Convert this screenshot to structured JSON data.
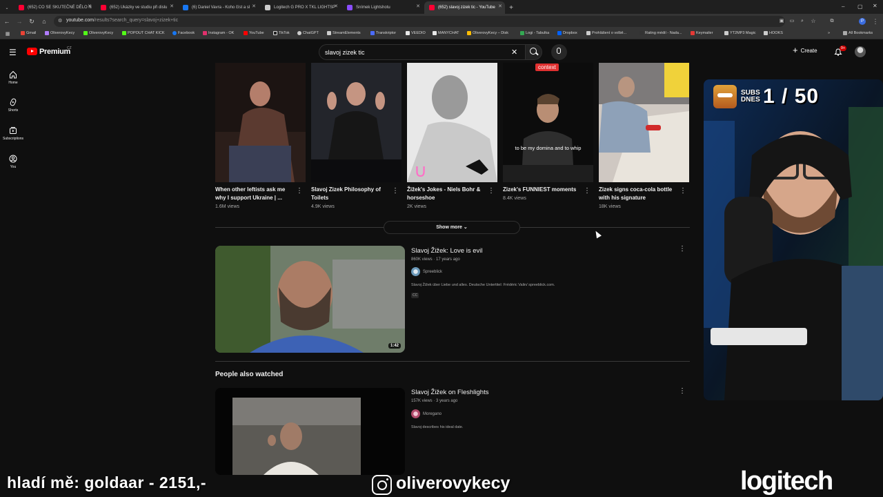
{
  "browser": {
    "tabs": [
      {
        "label": "(652) CO SE SKUTEČNÉ DĚLO N",
        "fav": "#ff0033"
      },
      {
        "label": "(652) Ukázky ve studiu při dislu",
        "fav": "#ff0033"
      },
      {
        "label": "(6) Daniel Vavra - Koho číst a sl",
        "fav": "#1877f2"
      },
      {
        "label": "Logitech G PRO X TKL LIGHTSP",
        "fav": "#cccccc"
      },
      {
        "label": "Snímek Lightshotu",
        "fav": "#8a4dff"
      },
      {
        "label": "(652) slavoj zizek tic - YouTube",
        "fav": "#ff0033"
      }
    ],
    "new_tab": "+",
    "url_host": "youtube.com",
    "url_path": "/results?search_query=slavoj+zizek+tic",
    "bookmarks": [
      {
        "label": "Gmail",
        "color": "#ea4335"
      },
      {
        "label": "OliverovyKecy",
        "color": "#b07cff"
      },
      {
        "label": "OliverovyKecy",
        "color": "#53fc18"
      },
      {
        "label": "POPOUT CHAT KICK",
        "color": "#53fc18"
      },
      {
        "label": "Facebook",
        "color": "#1877f2"
      },
      {
        "label": "Instagram - OK",
        "color": "#e1306c"
      },
      {
        "label": "YouTube",
        "color": "#ff0000"
      },
      {
        "label": "TikTok",
        "color": "#ffffff"
      },
      {
        "label": "ChatGPT",
        "color": "#cccccc"
      },
      {
        "label": "StreamElements",
        "color": "#cccccc"
      },
      {
        "label": "Transkriptor",
        "color": "#4b6bff"
      },
      {
        "label": "VEEDIO",
        "color": "#e8e8e8"
      },
      {
        "label": "MANYCHAT",
        "color": "#e8e8e8"
      },
      {
        "label": "OliverovyKecy – Disk",
        "color": "#fbbc04"
      },
      {
        "label": "Logi - Tabulka",
        "color": "#34a853"
      },
      {
        "label": "Dropbox",
        "color": "#0061ff"
      },
      {
        "label": "Prohlášení o volbě...",
        "color": "#cccccc"
      },
      {
        "label": "Rating médií - Nada...",
        "color": "#333333"
      },
      {
        "label": "Keymailer",
        "color": "#e53935"
      },
      {
        "label": "YT2MP3 Magic",
        "color": "#cccccc"
      },
      {
        "label": "HOOKS",
        "color": "#cccccc"
      }
    ],
    "all_bookmarks": "All Bookmarks"
  },
  "youtube": {
    "brand": "Premium",
    "country": "CZ",
    "search_query": "slavoj zizek tic",
    "create_label": "Create",
    "notifications": "9+",
    "guide": [
      {
        "label": "Home",
        "icon": "home-icon"
      },
      {
        "label": "Shorts",
        "icon": "shorts-icon"
      },
      {
        "label": "Subscriptions",
        "icon": "subscriptions-icon"
      },
      {
        "label": "You",
        "icon": "you-icon"
      }
    ],
    "shorts": [
      {
        "title": "When other leftists ask me why I support Ukraine | ...",
        "views": "1.6M views"
      },
      {
        "title": "Slavoj Zizek Philosophy of Toilets",
        "views": "4.9K views"
      },
      {
        "title": "Žižek's Jokes - Niels Bohr & horseshoe",
        "views": "2K views"
      },
      {
        "title": "Zizek's FUNNIEST moments",
        "views": "8.4K views",
        "overlay_tag": "context",
        "caption": "to be my domina and to whip"
      },
      {
        "title": "Zizek signs coca-cola bottle with his signature",
        "views": "18K views"
      }
    ],
    "show_more": "Show more",
    "results": [
      {
        "title": "Slavoj Žižek: Love is evil",
        "meta": "860K views · 17 years ago",
        "channel": "Spreeblick",
        "description": "Slavoj Žižek über Liebe und alles. Deutsche Untertitel: Frédéric Valin/ spreeblick.com.",
        "badge": "CC",
        "duration": "1:42"
      }
    ],
    "people_also_watched": "People also watched",
    "related": [
      {
        "title": "Slavoj Žižek on Fleshlights",
        "meta": "157K views · 3 years ago",
        "channel": "Moregano",
        "description": "Slavoj describes his ideal date."
      }
    ]
  },
  "overlay": {
    "subs_label": "SUBS DNES",
    "subs_count": "1 / 50",
    "donation": "hladí mě: goldaar - 2151,-",
    "instagram_handle": "oliverovykecy",
    "sponsor": "logitech"
  }
}
